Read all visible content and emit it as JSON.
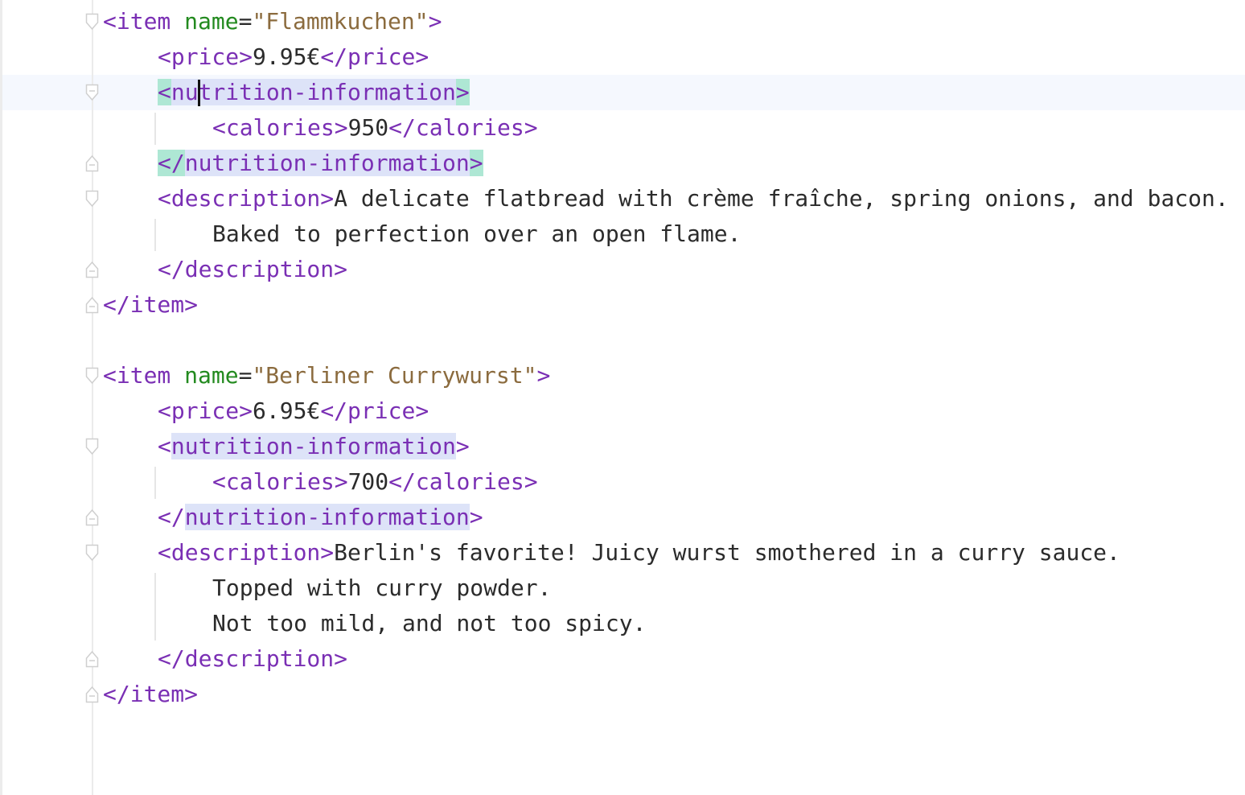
{
  "editor": {
    "language": "XML",
    "lines": [
      "<item name=\"Flammkuchen\">",
      "    <price>9.95€</price>",
      "    <nutrition-information>",
      "        <calories>950</calories>",
      "    </nutrition-information>",
      "    <description>A delicate flatbread with crème fraîche, spring onions, and bacon.",
      "        Baked to perfection over an open flame.",
      "    </description>",
      "</item>",
      "",
      "<item name=\"Berliner Currywurst\">",
      "    <price>6.95€</price>",
      "    <nutrition-information>",
      "        <calories>700</calories>",
      "    </nutrition-information>",
      "    <description>Berlin's favorite! Juicy wurst smothered in a curry sauce.",
      "        Topped with curry powder.",
      "        Not too mild, and not too spicy.",
      "    </description>",
      "</item>"
    ],
    "tokens": {
      "open_item": "<item",
      "close_item": "</item>",
      "name_attr": "name",
      "equals": "=",
      "close_angle": ">",
      "open_price": "<price>",
      "close_price": "</price>",
      "open_calories": "<calories>",
      "close_calories": "</calories>",
      "lt": "<",
      "lt_slash": "</",
      "nutrition_word_a": "nu",
      "nutrition_word_b": "trition-information",
      "nutrition_word": "nutrition-information",
      "open_description": "<description>",
      "close_description": "</description>"
    },
    "items": [
      {
        "name": "\"Flammkuchen\"",
        "price": "9.95€",
        "calories": "950",
        "description_lines": [
          "A delicate flatbread with crème fraîche, spring onions, and bacon.",
          "Baked to perfection over an open flame."
        ]
      },
      {
        "name": "\"Berliner Currywurst\"",
        "price": "6.95€",
        "calories": "700",
        "description_lines": [
          "Berlin's favorite! Juicy wurst smothered in a curry sauce.",
          "Topped with curry powder.",
          "Not too mild, and not too spicy."
        ]
      }
    ],
    "caret": {
      "line": 3,
      "column": 7
    },
    "colors": {
      "tag": "#7a2fb4",
      "attribute": "#238a1f",
      "attribute_value": "#8b6b3e",
      "text": "#2b2b2b",
      "tag_match_highlight": "#aee7d4",
      "identifier_highlight": "#dde3f8",
      "current_line": "#f5f8fe"
    },
    "icons": [
      "fold-open-icon",
      "fold-close-icon"
    ]
  }
}
